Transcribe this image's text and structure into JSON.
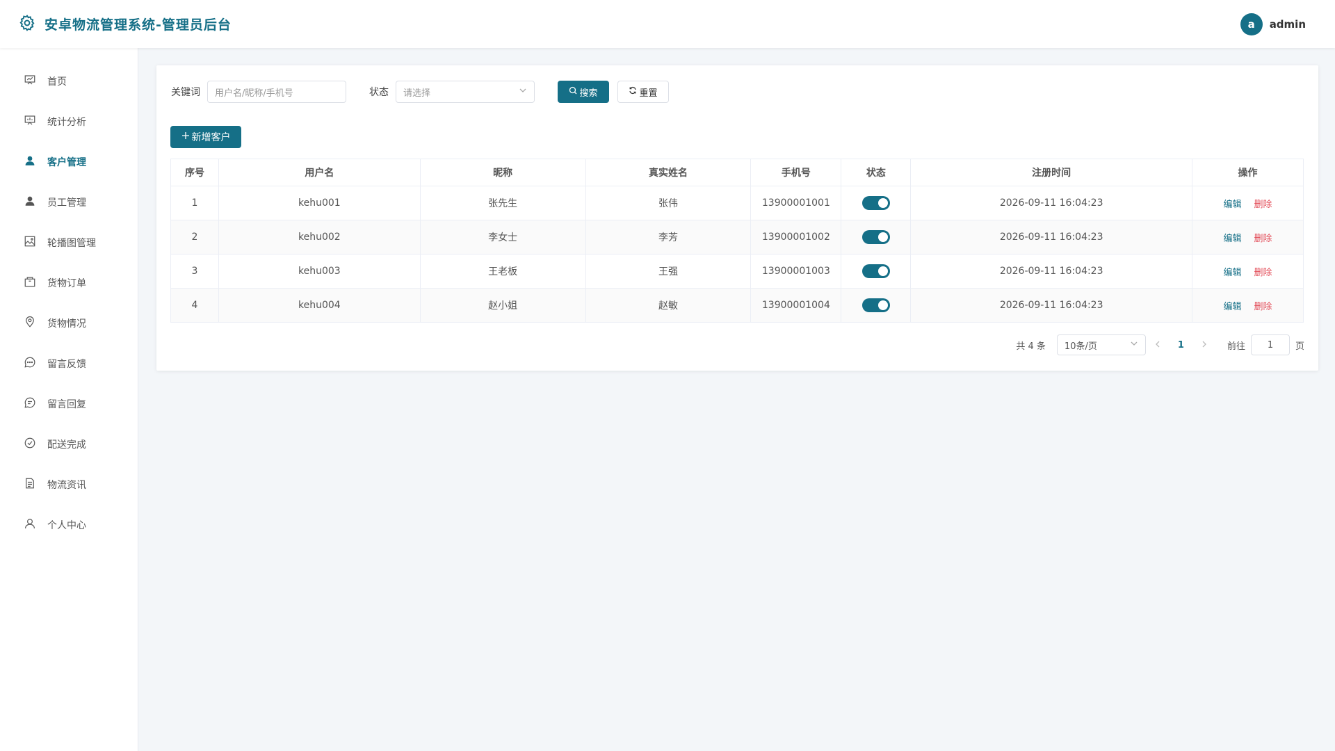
{
  "header": {
    "title": "安卓物流管理系统-管理员后台",
    "avatar_letter": "a",
    "username": "admin"
  },
  "sidebar": {
    "items": [
      {
        "label": "首页",
        "icon": "dashboard-icon"
      },
      {
        "label": "统计分析",
        "icon": "chart-board-icon"
      },
      {
        "label": "客户管理",
        "icon": "user-filled-icon",
        "active": true
      },
      {
        "label": "员工管理",
        "icon": "user-filled-icon"
      },
      {
        "label": "轮播图管理",
        "icon": "image-icon"
      },
      {
        "label": "货物订单",
        "icon": "box-icon"
      },
      {
        "label": "货物情况",
        "icon": "location-icon"
      },
      {
        "label": "留言反馈",
        "icon": "chat-dots-icon"
      },
      {
        "label": "留言回复",
        "icon": "chat-lines-icon"
      },
      {
        "label": "配送完成",
        "icon": "circle-check-icon"
      },
      {
        "label": "物流资讯",
        "icon": "document-icon"
      },
      {
        "label": "个人中心",
        "icon": "user-outline-icon"
      }
    ]
  },
  "search": {
    "keyword_label": "关键词",
    "keyword_placeholder": "用户名/昵称/手机号",
    "status_label": "状态",
    "status_placeholder": "请选择",
    "search_button": "搜索",
    "reset_button": "重置"
  },
  "add_button": "新增客户",
  "table": {
    "headers": [
      "序号",
      "用户名",
      "昵称",
      "真实姓名",
      "手机号",
      "状态",
      "注册时间",
      "操作"
    ],
    "rows": [
      {
        "index": "1",
        "username": "kehu001",
        "nickname": "张先生",
        "realname": "张伟",
        "phone": "13900001001",
        "enabled": true,
        "registered": "2026-09-11 16:04:23"
      },
      {
        "index": "2",
        "username": "kehu002",
        "nickname": "李女士",
        "realname": "李芳",
        "phone": "13900001002",
        "enabled": true,
        "registered": "2026-09-11 16:04:23"
      },
      {
        "index": "3",
        "username": "kehu003",
        "nickname": "王老板",
        "realname": "王强",
        "phone": "13900001003",
        "enabled": true,
        "registered": "2026-09-11 16:04:23"
      },
      {
        "index": "4",
        "username": "kehu004",
        "nickname": "赵小姐",
        "realname": "赵敏",
        "phone": "13900001004",
        "enabled": true,
        "registered": "2026-09-11 16:04:23"
      }
    ],
    "edit_label": "编辑",
    "delete_label": "删除"
  },
  "pagination": {
    "total_text": "共 4 条",
    "page_size": "10条/页",
    "current_page": "1",
    "goto_label": "前往",
    "goto_value": "1",
    "page_suffix": "页"
  },
  "colors": {
    "primary": "#156f87",
    "danger": "#e34d59"
  }
}
